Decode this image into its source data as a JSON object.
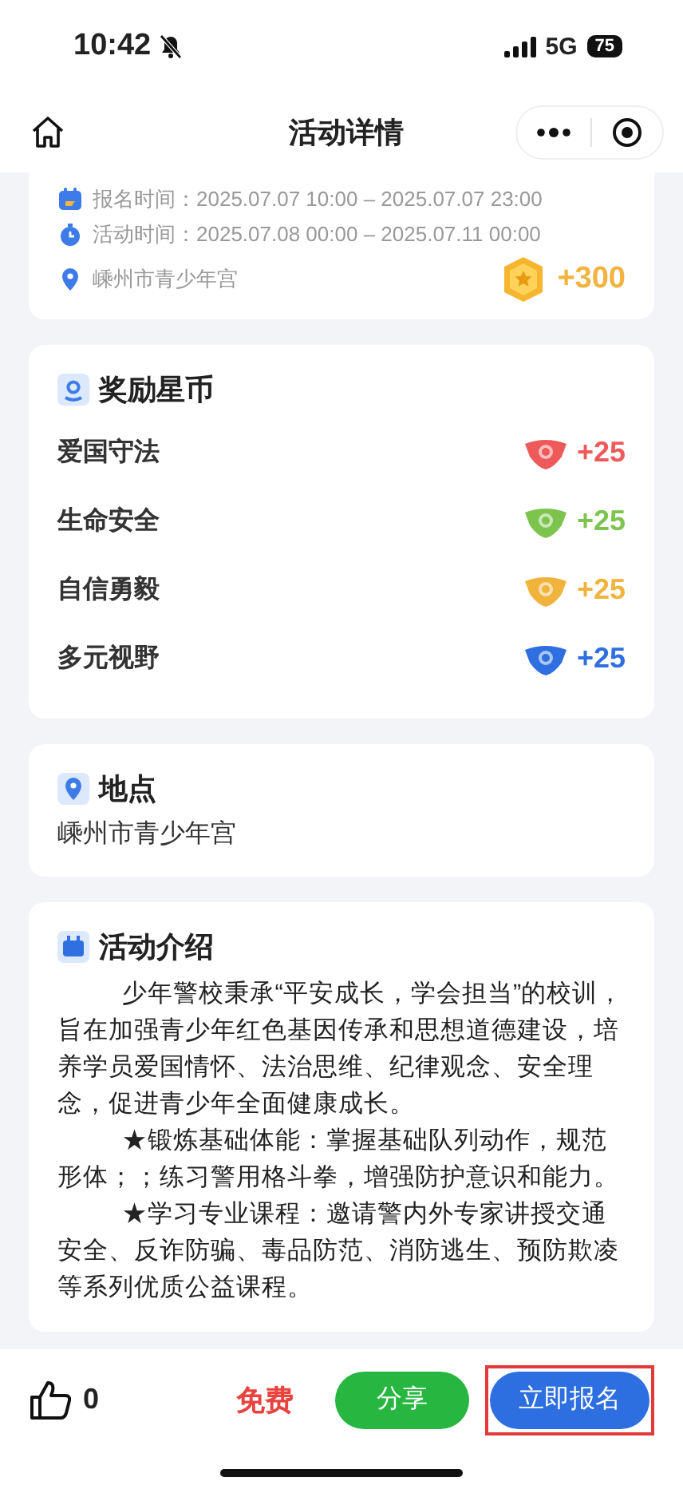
{
  "status_bar": {
    "time": "10:42",
    "silent": true,
    "network": "5G",
    "battery": "75"
  },
  "nav": {
    "title": "活动详情"
  },
  "summary": {
    "rows": [
      {
        "kind": "calendar",
        "text": "报名时间：2025.07.07 10:00 – 2025.07.07 23:00"
      },
      {
        "kind": "clock",
        "text": "活动时间：2025.07.08 00:00 – 2025.07.11 00:00"
      },
      {
        "kind": "pin",
        "text": "嵊州市青少年宫"
      }
    ],
    "coins": "+300"
  },
  "rewards": {
    "title": "奖励星币",
    "items": [
      {
        "name": "爱国守法",
        "amount": "+25",
        "color": "#ee5a5a"
      },
      {
        "name": "生命安全",
        "amount": "+25",
        "color": "#7cc44e"
      },
      {
        "name": "自信勇毅",
        "amount": "+25",
        "color": "#f0b43c"
      },
      {
        "name": "多元视野",
        "amount": "+25",
        "color": "#2f6fe0"
      }
    ]
  },
  "location": {
    "title": "地点",
    "text": "嵊州市青少年宫"
  },
  "intro": {
    "title": "活动介绍",
    "paragraphs": [
      "少年警校秉承“平安成长，学会担当”的校训，旨在加强青少年红色基因传承和思想道德建设，培养学员爱国情怀、法治思维、纪律观念、安全理念，促进青少年全面健康成长。",
      "★锻炼基础体能：掌握基础队列动作，规范形体；；练习警用格斗拳，增强防护意识和能力。",
      "★学习专业课程：邀请警内外专家讲授交通安全、反诈防骗、毒品防范、消防逃生、预防欺凌等系列优质公益课程。"
    ]
  },
  "bottom_bar": {
    "likes": "0",
    "price": "免费",
    "share": "分享",
    "signup": {
      "label": "立即报名",
      "highlighted": true
    }
  }
}
